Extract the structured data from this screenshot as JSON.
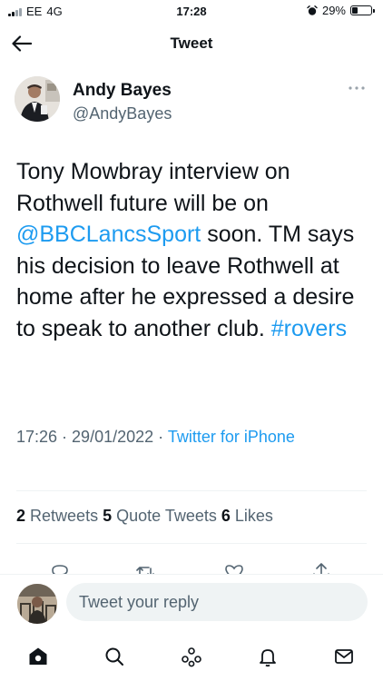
{
  "status_bar": {
    "carrier": "EE",
    "network": "4G",
    "time": "17:28",
    "battery": "29%",
    "battery_level": 0.29
  },
  "header": {
    "title": "Tweet",
    "back_icon": "arrow-left-icon"
  },
  "author": {
    "name": "Andy Bayes",
    "handle": "@AndyBayes",
    "more_icon": "more-horizontal-icon"
  },
  "tweet": {
    "part1": "Tony Mowbray interview on Rothwell future will be on ",
    "mention": "@BBCLancsSport",
    "part2": " soon. TM says his decision to leave Rothwell at home after he expressed a desire to speak to another club. ",
    "hashtag": "#rovers"
  },
  "meta": {
    "time": "17:26",
    "sep1": " · ",
    "date": "29/01/2022",
    "sep2": " · ",
    "source": "Twitter for iPhone"
  },
  "stats": {
    "retweets_count": "2",
    "retweets_label": "Retweets",
    "quotes_count": "5",
    "quotes_label": "Quote Tweets",
    "likes_count": "6",
    "likes_label": "Likes"
  },
  "actions": [
    "reply-icon",
    "retweet-icon",
    "like-icon",
    "share-icon"
  ],
  "reply": {
    "placeholder": "Tweet your reply"
  },
  "tab_bar": [
    "home-icon",
    "search-icon",
    "spaces-icon",
    "notifications-icon",
    "messages-icon"
  ],
  "colors": {
    "link": "#1d9bf0",
    "text": "#0f1419",
    "secondary": "#536471"
  }
}
